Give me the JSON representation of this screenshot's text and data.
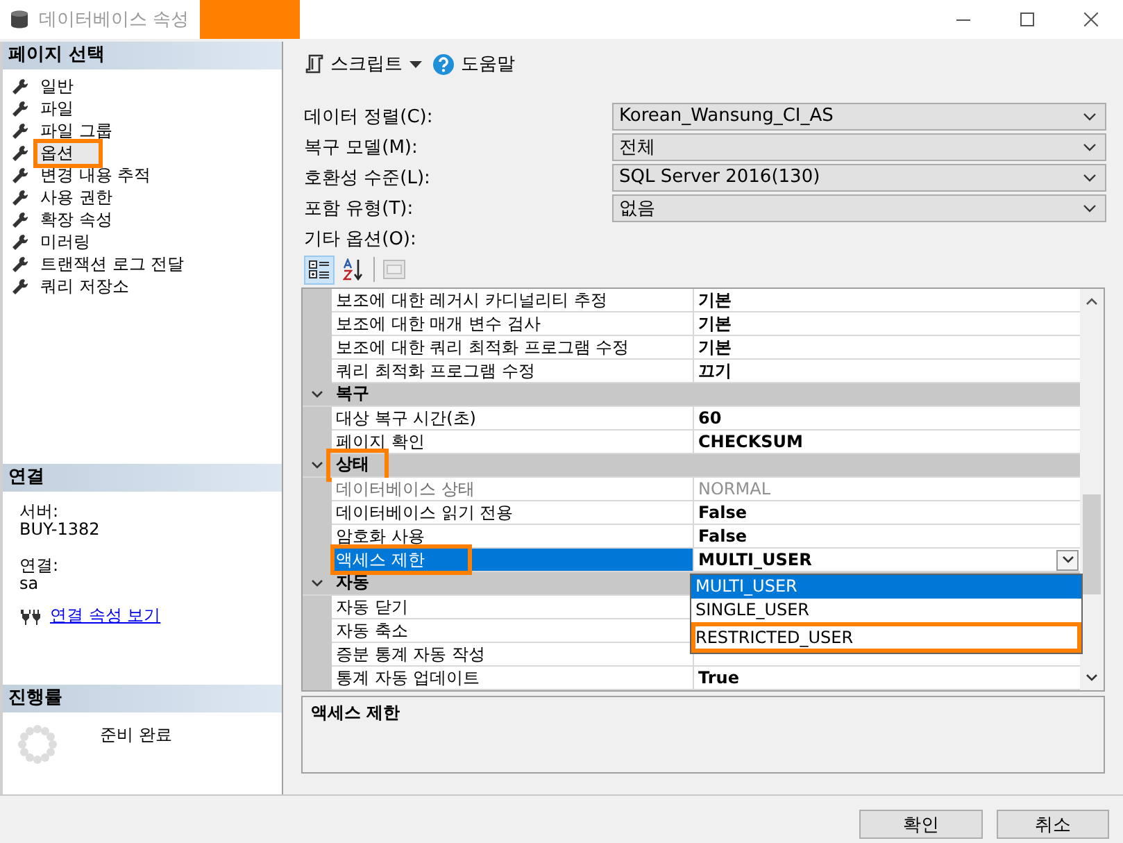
{
  "window": {
    "title": "데이터베이스 속성"
  },
  "sidebar": {
    "header": "페이지 선택",
    "items": [
      {
        "label": "일반",
        "selected": false,
        "highlighted": false
      },
      {
        "label": "파일",
        "selected": false,
        "highlighted": false
      },
      {
        "label": "파일 그룹",
        "selected": false,
        "highlighted": false
      },
      {
        "label": "옵션",
        "selected": true,
        "highlighted": true
      },
      {
        "label": "변경 내용 추적",
        "selected": false,
        "highlighted": false
      },
      {
        "label": "사용 권한",
        "selected": false,
        "highlighted": false
      },
      {
        "label": "확장 속성",
        "selected": false,
        "highlighted": false
      },
      {
        "label": "미러링",
        "selected": false,
        "highlighted": false
      },
      {
        "label": "트랜잭션 로그 전달",
        "selected": false,
        "highlighted": false
      },
      {
        "label": "쿼리 저장소",
        "selected": false,
        "highlighted": false
      }
    ]
  },
  "connection": {
    "header": "연결",
    "server_label": "서버:",
    "server": "BUY-1382",
    "connection_label": "연결:",
    "user": "sa",
    "link": "연결 속성 보기"
  },
  "progress": {
    "header": "진행률",
    "status": "준비 완료"
  },
  "toolbar": {
    "script": "스크립트",
    "help": "도움말"
  },
  "fields": [
    {
      "label": "데이터 정렬(C):",
      "value": "Korean_Wansung_CI_AS"
    },
    {
      "label": "복구 모델(M):",
      "value": "전체"
    },
    {
      "label": "호환성 수준(L):",
      "value": "SQL Server 2016(130)"
    },
    {
      "label": "포함 유형(T):",
      "value": "없음"
    }
  ],
  "other_options_label": "기타 옵션(O):",
  "grid_toolbar": [
    {
      "kind": "categorized",
      "selected": true,
      "disabled": false
    },
    {
      "kind": "alphabetical",
      "selected": false,
      "disabled": false
    },
    {
      "kind": "pages",
      "selected": false,
      "disabled": true
    }
  ],
  "property_grid": {
    "rows": [
      {
        "kind": "property",
        "name": "보조에 대한 레거시 카디널리티 추정",
        "value": "기본",
        "disabled": false,
        "selected": false,
        "highlighted": false
      },
      {
        "kind": "property",
        "name": "보조에 대한 매개 변수 검사",
        "value": "기본",
        "disabled": false,
        "selected": false,
        "highlighted": false
      },
      {
        "kind": "property",
        "name": "보조에 대한 쿼리 최적화 프로그램 수정",
        "value": "기본",
        "disabled": false,
        "selected": false,
        "highlighted": false
      },
      {
        "kind": "property",
        "name": "쿼리 최적화 프로그램 수정",
        "value": "끄기",
        "disabled": false,
        "selected": false,
        "highlighted": false
      },
      {
        "kind": "category",
        "name": "복구",
        "expanded": true,
        "highlighted": false
      },
      {
        "kind": "property",
        "name": "대상 복구 시간(초)",
        "value": "60",
        "disabled": false,
        "selected": false,
        "highlighted": false
      },
      {
        "kind": "property",
        "name": "페이지 확인",
        "value": "CHECKSUM",
        "disabled": false,
        "selected": false,
        "highlighted": false
      },
      {
        "kind": "category",
        "name": "상태",
        "expanded": true,
        "highlighted": true
      },
      {
        "kind": "property",
        "name": "데이터베이스 상태",
        "value": "NORMAL",
        "disabled": true,
        "selected": false,
        "highlighted": false
      },
      {
        "kind": "property",
        "name": "데이터베이스 읽기 전용",
        "value": "False",
        "disabled": false,
        "selected": false,
        "highlighted": false
      },
      {
        "kind": "property",
        "name": "암호화 사용",
        "value": "False",
        "disabled": false,
        "selected": false,
        "highlighted": false
      },
      {
        "kind": "property",
        "name": "액세스 제한",
        "value": "MULTI_USER",
        "disabled": false,
        "selected": true,
        "highlighted": true
      },
      {
        "kind": "category",
        "name": "자동",
        "expanded": true,
        "highlighted": false
      },
      {
        "kind": "property",
        "name": "자동 닫기",
        "disabled": false,
        "selected": false,
        "highlighted": false
      },
      {
        "kind": "property",
        "name": "자동 축소",
        "disabled": false,
        "selected": false,
        "highlighted": false
      },
      {
        "kind": "property",
        "name": "증분 통계 자동 작성",
        "disabled": false,
        "selected": false,
        "highlighted": false
      },
      {
        "kind": "property",
        "name": "통계 자동 업데이트",
        "value": "True",
        "disabled": false,
        "selected": false,
        "highlighted": false
      }
    ]
  },
  "dropdown": {
    "options": [
      {
        "label": "MULTI_USER",
        "selected": true,
        "highlighted": false
      },
      {
        "label": "SINGLE_USER",
        "selected": false,
        "highlighted": false
      },
      {
        "label": "RESTRICTED_USER",
        "selected": false,
        "highlighted": true
      }
    ]
  },
  "description": {
    "title": "액세스 제한"
  },
  "buttons": [
    {
      "label": "확인"
    },
    {
      "label": "취소"
    }
  ]
}
